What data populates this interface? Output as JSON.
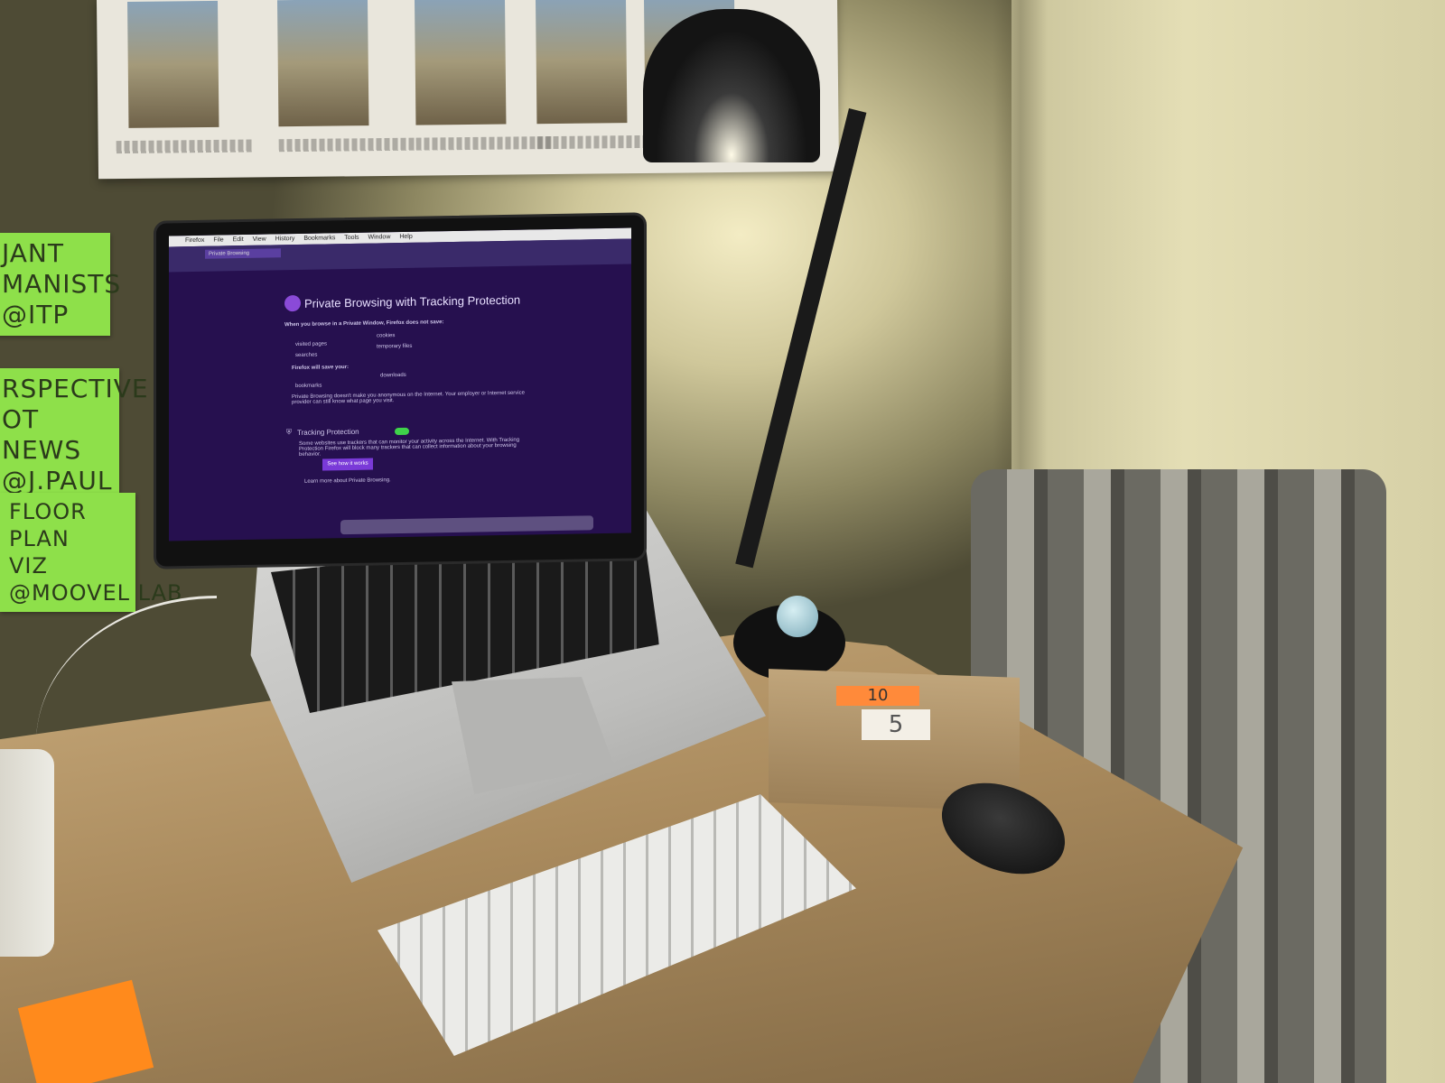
{
  "screen": {
    "menubar": [
      "Firefox",
      "File",
      "Edit",
      "View",
      "History",
      "Bookmarks",
      "Tools",
      "Window",
      "Help"
    ],
    "tab_label": "Private Browsing",
    "title": "Private Browsing with Tracking Protection",
    "intro": "When you browse in a Private Window, Firefox does not save:",
    "not_saved": [
      "visited pages",
      "searches",
      "cookies",
      "temporary files"
    ],
    "will_save_label": "Firefox will save your:",
    "saved": [
      "bookmarks",
      "downloads"
    ],
    "disclaimer": "Private Browsing doesn't make you anonymous on the Internet. Your employer or Internet service provider can still know what page you visit.",
    "tracking_title": "Tracking Protection",
    "tracking_text": "Some websites use trackers that can monitor your activity across the Internet. With Tracking Protection Firefox will block many trackers that can collect information about your browsing behavior.",
    "cta_label": "See how it works",
    "learn_more": "Learn more about Private Browsing."
  },
  "sticky_notes": [
    "JANT\nMANISTS\n@ITP",
    "RSPECTIVE\nOT\nNEWS\n@J.PAUL",
    "FLOOR\nPLAN\nVIZ\n@MOOVEL LAB"
  ],
  "box": {
    "tag": "10",
    "label": "5"
  },
  "colors": {
    "screen_bg": "#26104f",
    "sticky_green": "#8ee04a",
    "sticky_orange": "#ff8a1c",
    "cta": "#7a3ad8",
    "toggle_on": "#3fd24a"
  }
}
